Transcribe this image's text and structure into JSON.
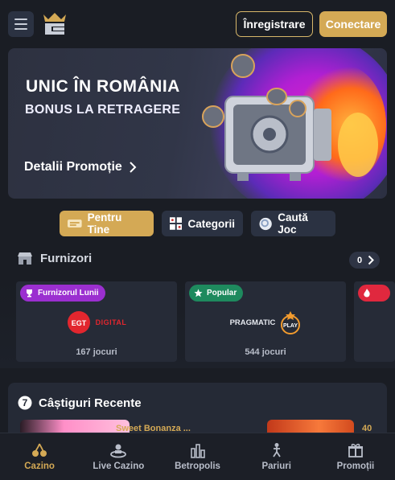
{
  "header": {
    "register_label": "Înregistrare",
    "login_label": "Conectare"
  },
  "banner": {
    "title": "UNIC ÎN ROMÂNIA",
    "subtitle": "BONUS LA RETRAGERE",
    "link_label": "Detalii Promoție"
  },
  "quick_nav": [
    {
      "label": "Pentru Tine",
      "icon": "cards-icon",
      "active": true
    },
    {
      "label": "Categorii",
      "icon": "grid-icon",
      "active": false
    },
    {
      "label": "Caută Joc",
      "icon": "search-icon",
      "active": false
    }
  ],
  "providers": {
    "title": "Furnizori",
    "count": "0",
    "cards": [
      {
        "tag": "Furnizorul Lunii",
        "tag_color": "#9b2fd0",
        "logo": "EGT DIGITAL",
        "games": "167 jocuri"
      },
      {
        "tag": "Popular",
        "tag_color": "#1e8a5e",
        "logo": "PRAGMATIC PLAY",
        "games": "544 jocuri"
      }
    ]
  },
  "recent_wins": {
    "title": "Câștiguri Recente",
    "game": "Sweet Bonanza ...",
    "amount": "40"
  },
  "bottom_nav": [
    {
      "label": "Cazino",
      "icon": "cherry-icon",
      "active": true
    },
    {
      "label": "Live Cazino",
      "icon": "dealer-icon",
      "active": false
    },
    {
      "label": "Betropolis",
      "icon": "city-icon",
      "active": false
    },
    {
      "label": "Pariuri",
      "icon": "player-icon",
      "active": false
    },
    {
      "label": "Promoții",
      "icon": "gift-icon",
      "active": false
    }
  ],
  "colors": {
    "accent": "#d4a955",
    "background": "#1a1d24",
    "panel": "#2b3242"
  }
}
